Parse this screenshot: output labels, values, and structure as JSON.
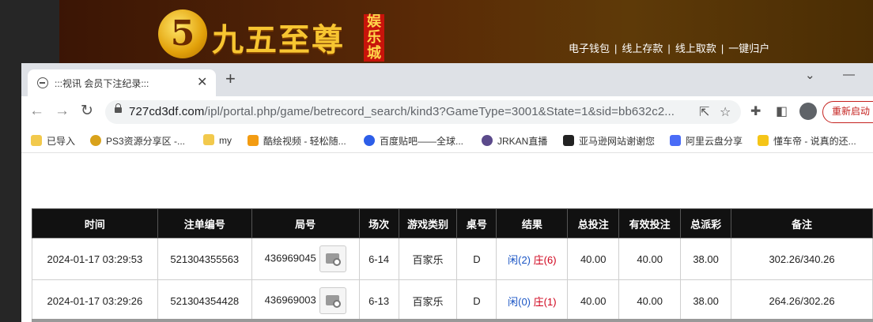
{
  "site": {
    "logo_numeral": "5",
    "logo_text": "九五至尊",
    "logo_tag": "娱乐城",
    "links": [
      "电子钱包",
      "线上存款",
      "线上取款",
      "一键归户"
    ]
  },
  "browser": {
    "tab_title": ":::视讯 会员下注纪录:::",
    "url_host": "727cd3df.com",
    "url_path": "/ipl/portal.php/game/betrecord_search/kind3?GameType=3001&State=1&sid=bb632c2...",
    "restart_label": "重新启动"
  },
  "bookmarks": [
    {
      "label": "已导入",
      "icon": "folder-icon",
      "color": "#f2c94c"
    },
    {
      "label": "PS3资源分享区 -...",
      "icon": "ps3-site-icon",
      "color": "#d9a21b"
    },
    {
      "label": "my",
      "icon": "folder-icon",
      "color": "#f2c94c"
    },
    {
      "label": "酷绘视频 - 轻松随...",
      "icon": "k-logo-icon",
      "color": "#f39c12"
    },
    {
      "label": "百度贴吧——全球...",
      "icon": "baidu-paw-icon",
      "color": "#2d5ee8"
    },
    {
      "label": "JRKAN直播",
      "icon": "jrkan-icon",
      "color": "#5b4a8b"
    },
    {
      "label": "亚马逊网站谢谢您",
      "icon": "amazon-icon",
      "color": "#222222"
    },
    {
      "label": "阿里云盘分享",
      "icon": "aliyun-icon",
      "color": "#4a6cf7"
    },
    {
      "label": "懂车帝 - 说真的还...",
      "icon": "dongchedi-icon",
      "color": "#f5c518"
    }
  ],
  "table": {
    "headers": [
      "时间",
      "注单编号",
      "局号",
      "场次",
      "游戏类别",
      "桌号",
      "结果",
      "总投注",
      "有效投注",
      "总派彩",
      "备注"
    ],
    "rows": [
      {
        "time": "2024-01-17 03:29:53",
        "bet_id": "521304355563",
        "round": "436969045",
        "session": "6-14",
        "game": "百家乐",
        "table": "D",
        "player": "闲(2)",
        "banker": "庄(6)",
        "total_bet": "40.00",
        "valid_bet": "40.00",
        "payout": "38.00",
        "note": "302.26/340.26"
      },
      {
        "time": "2024-01-17 03:29:26",
        "bet_id": "521304354428",
        "round": "436969003",
        "session": "6-13",
        "game": "百家乐",
        "table": "D",
        "player": "闲(0)",
        "banker": "庄(1)",
        "total_bet": "40.00",
        "valid_bet": "40.00",
        "payout": "38.00",
        "note": "264.26/302.26"
      }
    ]
  }
}
